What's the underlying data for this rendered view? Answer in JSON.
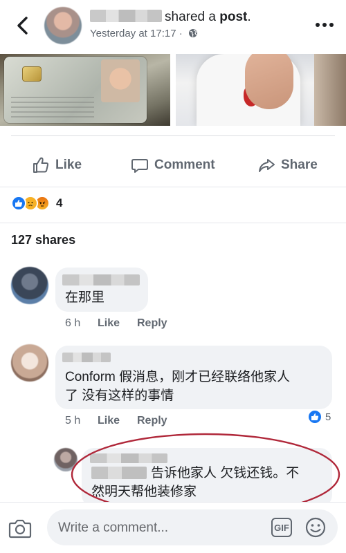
{
  "header": {
    "action_text": "shared a",
    "object_text": "post",
    "end_punct": ".",
    "timestamp": "Yesterday at 17:17",
    "separator": "·",
    "privacy_icon": "globe-icon",
    "back_icon": "back-arrow-icon",
    "more_icon": "more-dots-icon"
  },
  "actions": {
    "like": "Like",
    "comment": "Comment",
    "share": "Share"
  },
  "reactions": {
    "types": [
      "like",
      "sad",
      "angry"
    ],
    "count": "4"
  },
  "shares_text": "127 shares",
  "comments": [
    {
      "text_lines": [
        "在那里"
      ],
      "time": "6 h",
      "like_label": "Like",
      "reply_label": "Reply"
    },
    {
      "text_lines": [
        "Conform 假消息，刚才已经联络他家人",
        "了 没有这样的事情"
      ],
      "time": "5 h",
      "like_label": "Like",
      "reply_label": "Reply",
      "reaction_count": "5"
    },
    {
      "text_lines": [
        "告诉他家人 欠钱还钱。不",
        "然明天帮他装修家"
      ]
    }
  ],
  "composer": {
    "placeholder": "Write a comment...",
    "gif_label": "GIF",
    "camera_icon": "camera-icon",
    "emoji_icon": "emoji-icon"
  },
  "colors": {
    "accent_blue": "#1877f2",
    "text_primary": "#1c1e21",
    "text_secondary": "#606770",
    "bubble_bg": "#f0f2f5",
    "highlight_oval": "#b0283a"
  }
}
